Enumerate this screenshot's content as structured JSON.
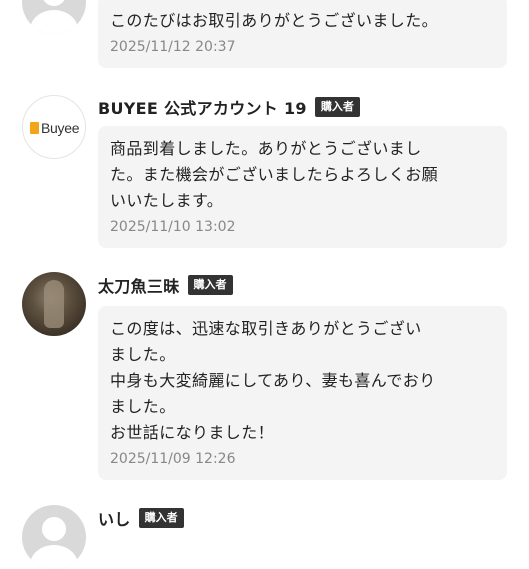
{
  "reviews": [
    {
      "avatar": "default-user-avatar",
      "message": "このたびはお取引ありがとうございました。",
      "date": "2025/11/12 20:37"
    },
    {
      "name": "BUYEE 公式アカウント 19",
      "badge": "購入者",
      "avatar_logo_text": "Buyee",
      "message": "商品到着しました。ありがとうございまし\nた。また機会がございましたらよろしくお願\nいいたします。",
      "date": "2025/11/10 13:02"
    },
    {
      "name": "太刀魚三昧",
      "badge": "購入者",
      "avatar": "photo-avatar",
      "message": "この度は、迅速な取引きありがとうござい\nました。\n中身も大変綺麗にしてあり、妻も喜んでおり\nました。\nお世話になりました！",
      "date": "2025/11/09 12:26"
    },
    {
      "name": "いし",
      "badge": "購入者",
      "avatar": "default-user-avatar"
    }
  ],
  "colors": {
    "bubble_bg": "#f4f4f4",
    "badge_bg": "#333333",
    "date_text": "#888888",
    "buyee_orange": "#f2a51a"
  }
}
